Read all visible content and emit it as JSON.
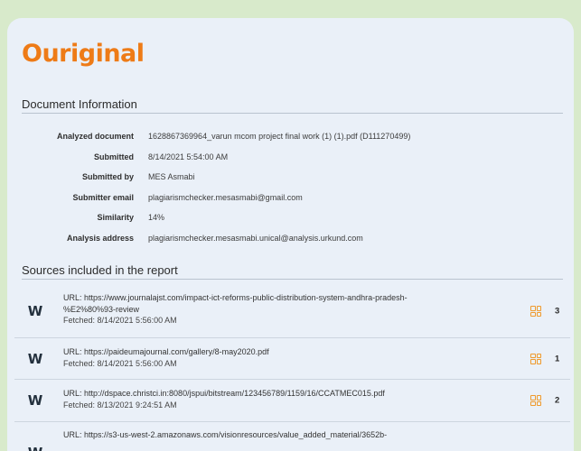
{
  "brand": {
    "logo_text": "Ouriginal",
    "color": "#ee7b17"
  },
  "document_info": {
    "title": "Document Information",
    "rows": [
      {
        "label": "Analyzed document",
        "value": "1628867369964_varun mcom project final work (1) (1).pdf (D111270499)"
      },
      {
        "label": "Submitted",
        "value": "8/14/2021 5:54:00 AM"
      },
      {
        "label": "Submitted by",
        "value": "MES Asmabi"
      },
      {
        "label": "Submitter email",
        "value": "plagiarismchecker.mesasmabi@gmail.com"
      },
      {
        "label": "Similarity",
        "value": "14%"
      },
      {
        "label": "Analysis address",
        "value": "plagiarismchecker.mesasmabi.unical@analysis.urkund.com"
      }
    ]
  },
  "sources": {
    "title": "Sources included in the report",
    "items": [
      {
        "icon": "W",
        "url_line1": "URL: https://www.journalajst.com/impact-ict-reforms-public-distribution-system-andhra-pradesh-",
        "url_line2": "%E2%80%93-review",
        "fetched": "Fetched: 8/14/2021 5:56:00 AM",
        "count": "3"
      },
      {
        "icon": "W",
        "url_line1": "URL: https://paideumajournal.com/gallery/8-may2020.pdf",
        "fetched": "Fetched: 8/14/2021 5:56:00 AM",
        "count": "1"
      },
      {
        "icon": "W",
        "url_line1": "URL: http://dspace.christci.in:8080/jspui/bitstream/123456789/1159/16/CCATMEC015.pdf",
        "fetched": "Fetched: 8/13/2021 9:24:51 AM",
        "count": "2"
      },
      {
        "icon": "W",
        "url_line1": "URL: https://s3-us-west-2.amazonaws.com/visionresources/value_added_material/3652b-"
      }
    ]
  }
}
